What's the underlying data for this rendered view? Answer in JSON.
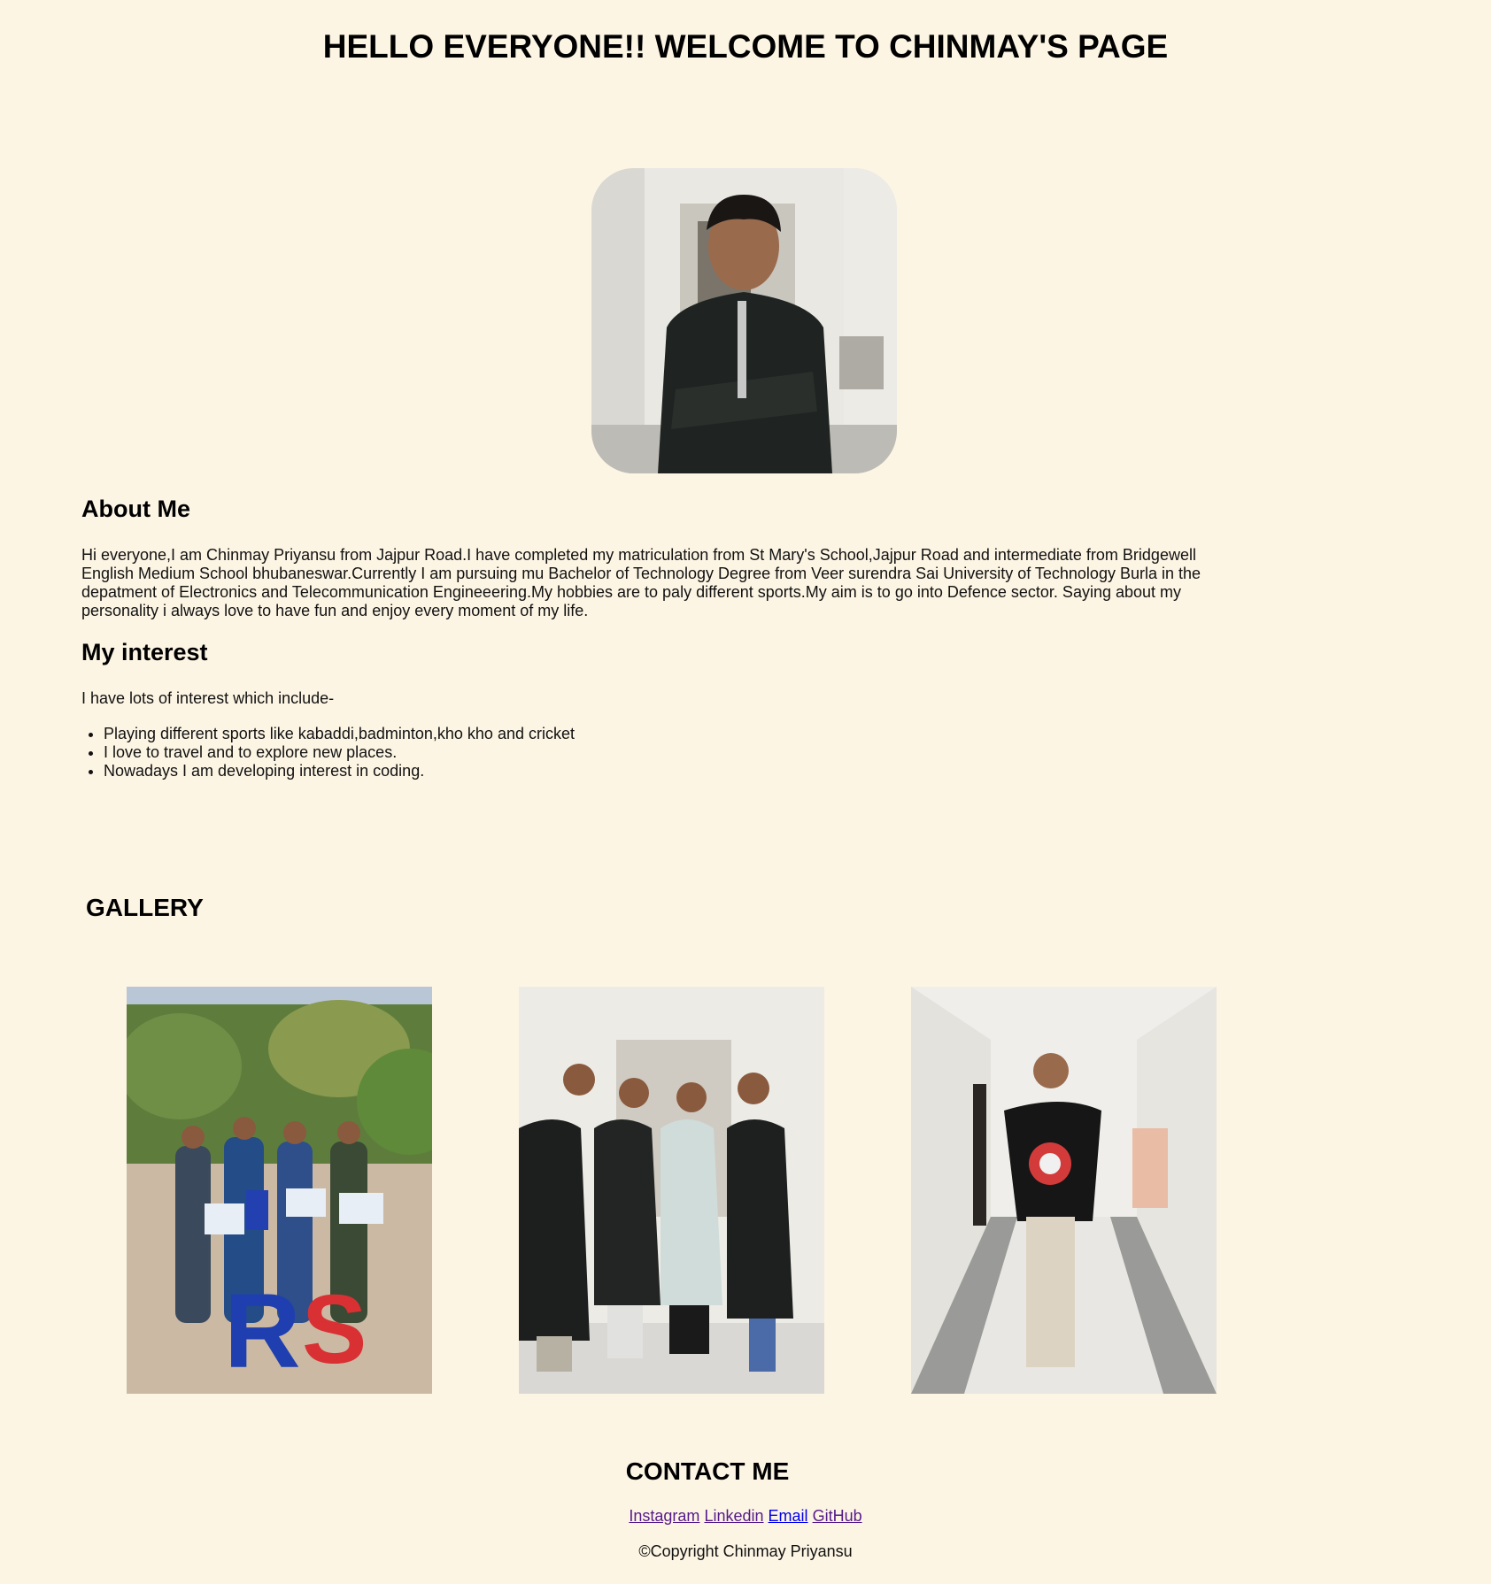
{
  "header": {
    "title": "HELLO EVERYONE!! WELCOME TO CHINMAY'S PAGE"
  },
  "about": {
    "heading": "About Me",
    "text": "Hi everyone,I am Chinmay Priyansu from Jajpur Road.I have completed my matriculation from St Mary's School,Jajpur Road and intermediate from Bridgewell English Medium School bhubaneswar.Currently I am pursuing mu Bachelor of Technology Degree from Veer surendra Sai University of Technology Burla in the depatment of Electronics and Telecommunication Engineeering.My hobbies are to paly different sports.My aim is to go into Defence sector. Saying about my personality i always love to have fun and enjoy every moment of my life."
  },
  "interest": {
    "heading": "My interest",
    "intro": "I have lots of interest which include-",
    "items": [
      "Playing different sports like kabaddi,badminton,kho kho and cricket",
      "I love to travel and to explore new places.",
      "Nowadays I am developing interest in coding."
    ]
  },
  "gallery": {
    "heading": "GALLERY"
  },
  "contact": {
    "heading": "CONTACT ME",
    "links": [
      "Instagram",
      "Linkedin",
      "Email",
      "GitHub"
    ],
    "copyright": "©Copyright Chinmay Priyansu"
  },
  "colors": {
    "background": "#fdf5e4",
    "visited_link": "#551a8b",
    "unvisited_link": "#0000ee"
  }
}
